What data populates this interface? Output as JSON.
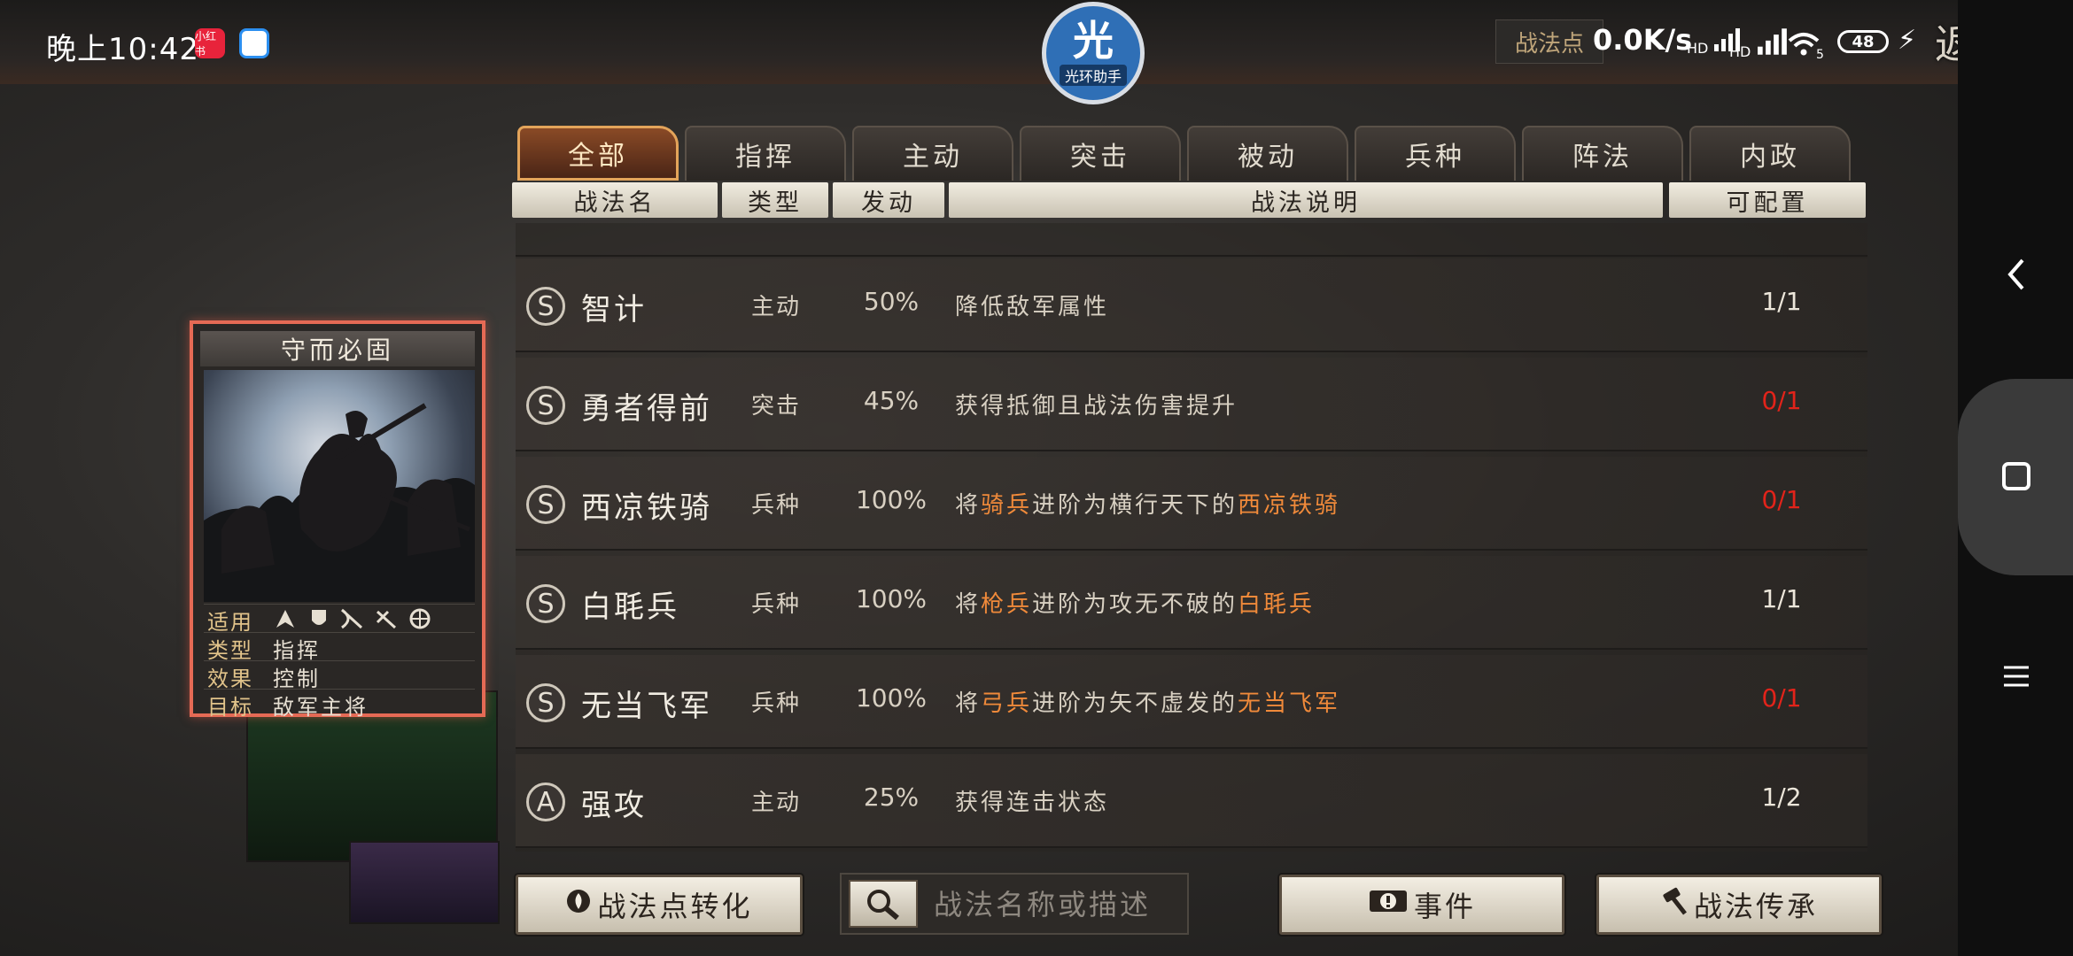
{
  "status_bar": {
    "time": "晚上10:42",
    "app_red_label": "小红书",
    "net_speed": "0.0K/s",
    "sig1": "HD",
    "sig2": "HD",
    "wifi_sub": "5",
    "battery": "48"
  },
  "assistant": {
    "logo_char": "光",
    "logo_text": "光环助手"
  },
  "header": {
    "points_label": "战法点",
    "back_label": "返回"
  },
  "tabs": [
    "全部",
    "指挥",
    "主动",
    "突击",
    "被动",
    "兵种",
    "阵法",
    "内政"
  ],
  "active_tab": 0,
  "columns": [
    "战法名",
    "类型",
    "发动",
    "战法说明",
    "可配置"
  ],
  "rows": [
    {
      "grade": "S",
      "name": "智计",
      "type": "主动",
      "rate": "50%",
      "desc": [
        {
          "t": "降低敌军属性"
        }
      ],
      "count": "1/1",
      "count_red": false
    },
    {
      "grade": "S",
      "name": "勇者得前",
      "type": "突击",
      "rate": "45%",
      "desc": [
        {
          "t": "获得抵御且战法伤害提升"
        }
      ],
      "count": "0/1",
      "count_red": true
    },
    {
      "grade": "S",
      "name": "西凉铁骑",
      "type": "兵种",
      "rate": "100%",
      "desc": [
        {
          "t": "将"
        },
        {
          "t": "骑兵",
          "hl": true
        },
        {
          "t": "进阶为横行天下的"
        },
        {
          "t": "西凉铁骑",
          "hl": true
        }
      ],
      "count": "0/1",
      "count_red": true
    },
    {
      "grade": "S",
      "name": "白毦兵",
      "type": "兵种",
      "rate": "100%",
      "desc": [
        {
          "t": "将"
        },
        {
          "t": "枪兵",
          "hl": true
        },
        {
          "t": "进阶为攻无不破的"
        },
        {
          "t": "白毦兵",
          "hl": true
        }
      ],
      "count": "1/1",
      "count_red": false
    },
    {
      "grade": "S",
      "name": "无当飞军",
      "type": "兵种",
      "rate": "100%",
      "desc": [
        {
          "t": "将"
        },
        {
          "t": "弓兵",
          "hl": true
        },
        {
          "t": "进阶为矢不虚发的"
        },
        {
          "t": "无当飞军",
          "hl": true
        }
      ],
      "count": "0/1",
      "count_red": true
    },
    {
      "grade": "A",
      "name": "强攻",
      "type": "主动",
      "rate": "25%",
      "desc": [
        {
          "t": "获得连击状态"
        }
      ],
      "count": "1/2",
      "count_red": false
    }
  ],
  "card": {
    "title": "守而必固",
    "stats": [
      {
        "k": "适用",
        "v": ""
      },
      {
        "k": "类型",
        "v": "指挥"
      },
      {
        "k": "效果",
        "v": "控制"
      },
      {
        "k": "目标",
        "v": "敌军主将"
      }
    ]
  },
  "buttons": {
    "convert": "战法点转化",
    "event": "事件",
    "inherit": "战法传承"
  },
  "search": {
    "placeholder": "战法名称或描述"
  },
  "colors": {
    "highlight": "#f08a3a",
    "count_red": "#e2231a",
    "active_tab_border": "#e3a45a"
  }
}
